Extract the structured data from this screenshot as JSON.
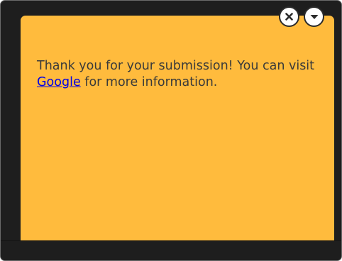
{
  "note": {
    "message_before_link": "Thank you for your submission! You can visit ",
    "link_text": "Google",
    "message_after_link": " for more information."
  },
  "controls": {
    "close_icon": "close-icon",
    "collapse_icon": "caret-down-icon"
  },
  "colors": {
    "note_background": "#ffbb3d",
    "frame_background": "#1e1e1e",
    "text": "#3a3a3a",
    "link": "#0000e8"
  }
}
